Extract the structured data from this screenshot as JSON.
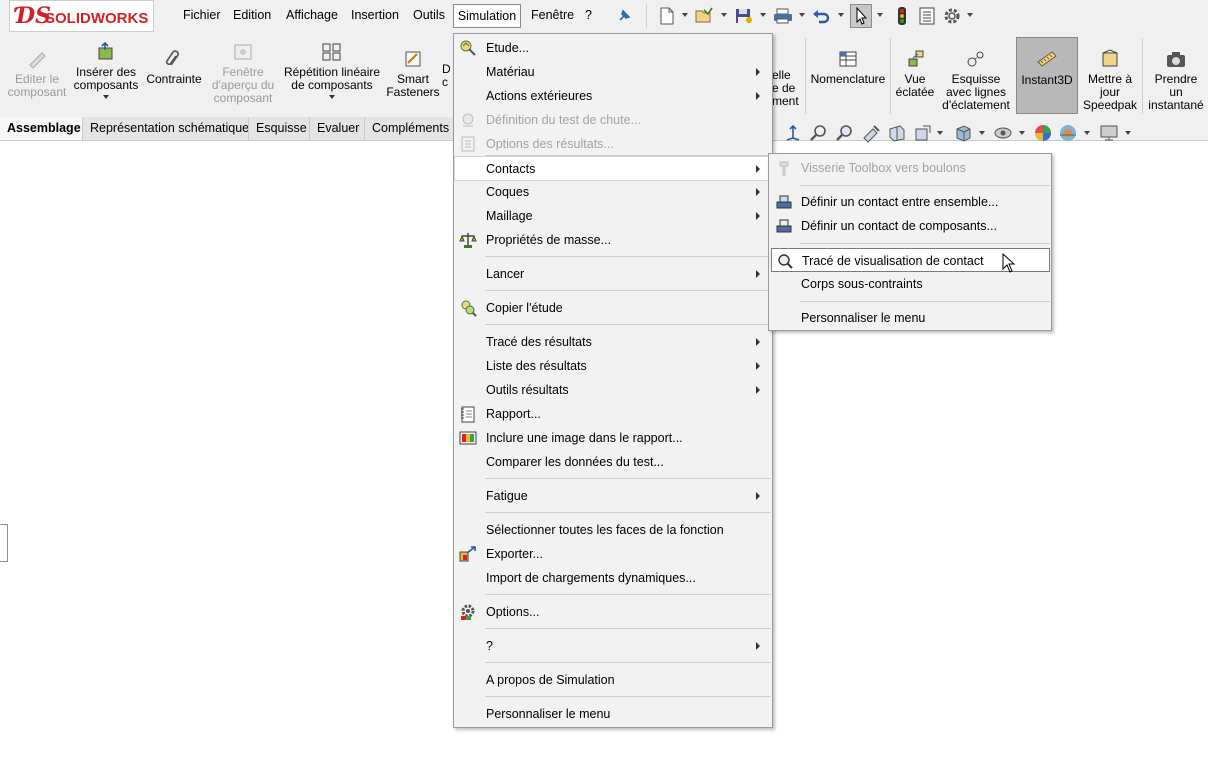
{
  "app": {
    "logo_ds": "ƊS",
    "logo_text": "SOLIDWORKS"
  },
  "menubar": {
    "items": [
      "Fichier",
      "Edition",
      "Affichage",
      "Insertion",
      "Outils",
      "Simulation",
      "Fenêtre",
      "?"
    ]
  },
  "ribbon": {
    "left_commands": [
      {
        "label_1": "Editer le",
        "label_2": "composant",
        "label_3": "",
        "disabled": true
      },
      {
        "label_1": "Insérer des",
        "label_2": "composants",
        "label_3": "",
        "disabled": false
      },
      {
        "label_1": "Contrainte",
        "label_2": "",
        "label_3": "",
        "disabled": false
      },
      {
        "label_1": "Fenêtre",
        "label_2": "d'aperçu du",
        "label_3": "composant",
        "disabled": true
      },
      {
        "label_1": "Répétition linéaire",
        "label_2": "de composants",
        "label_3": "",
        "disabled": false
      },
      {
        "label_1": "Smart",
        "label_2": "Fasteners",
        "label_3": "",
        "disabled": false
      },
      {
        "label_1": "D",
        "label_2": "c",
        "label_3": "",
        "disabled": false
      }
    ],
    "right_commands": [
      {
        "label_1": "elle",
        "label_2": "e de",
        "label_3": "ment"
      },
      {
        "label_1": "Nomenclature",
        "label_2": "",
        "label_3": ""
      },
      {
        "label_1": "Vue",
        "label_2": "éclatée",
        "label_3": ""
      },
      {
        "label_1": "Esquisse",
        "label_2": "avec lignes",
        "label_3": "d'éclatement"
      },
      {
        "label_1": "Instant3D",
        "label_2": "",
        "label_3": ""
      },
      {
        "label_1": "Mettre à",
        "label_2": "jour",
        "label_3": "Speedpak"
      },
      {
        "label_1": "Prendre",
        "label_2": "un",
        "label_3": "instantané"
      }
    ]
  },
  "tabs": [
    "Assemblage",
    "Représentation schématique",
    "Esquisse",
    "Evaluer",
    "Compléments"
  ],
  "simulation_menu": {
    "items": [
      {
        "label": "Etude...",
        "disabled": false,
        "submenu": false,
        "icon": "study-icon"
      },
      {
        "label": "Matériau",
        "disabled": false,
        "submenu": true,
        "icon": ""
      },
      {
        "label": "Actions extérieures",
        "disabled": false,
        "submenu": true,
        "icon": ""
      },
      {
        "label": "Définition du test de chute...",
        "disabled": true,
        "submenu": false,
        "icon": "drop-test-icon"
      },
      {
        "label": "Options des résultats...",
        "disabled": true,
        "submenu": false,
        "icon": "result-options-icon"
      },
      {
        "label": "Contacts",
        "disabled": false,
        "submenu": true,
        "icon": ""
      },
      {
        "label": "Coques",
        "disabled": false,
        "submenu": true,
        "icon": ""
      },
      {
        "label": "Maillage",
        "disabled": false,
        "submenu": true,
        "icon": ""
      },
      {
        "label": "Propriétés de masse...",
        "disabled": false,
        "submenu": false,
        "icon": "mass-properties-icon"
      },
      {
        "label": "Lancer",
        "disabled": false,
        "submenu": true,
        "icon": ""
      },
      {
        "label": "Copier l'étude",
        "disabled": false,
        "submenu": false,
        "icon": "copy-study-icon"
      },
      {
        "label": "Tracé des résultats",
        "disabled": false,
        "submenu": true,
        "icon": ""
      },
      {
        "label": "Liste des résultats",
        "disabled": false,
        "submenu": true,
        "icon": ""
      },
      {
        "label": "Outils résultats",
        "disabled": false,
        "submenu": true,
        "icon": ""
      },
      {
        "label": "Rapport...",
        "disabled": false,
        "submenu": false,
        "icon": "report-icon"
      },
      {
        "label": "Inclure une image dans le rapport...",
        "disabled": false,
        "submenu": false,
        "icon": "include-image-icon"
      },
      {
        "label": "Comparer les données du test...",
        "disabled": false,
        "submenu": false,
        "icon": ""
      },
      {
        "label": "Fatigue",
        "disabled": false,
        "submenu": true,
        "icon": ""
      },
      {
        "label": "Sélectionner toutes les faces de la fonction",
        "disabled": false,
        "submenu": false,
        "icon": ""
      },
      {
        "label": "Exporter...",
        "disabled": false,
        "submenu": false,
        "icon": "export-icon"
      },
      {
        "label": "Import de chargements dynamiques...",
        "disabled": false,
        "submenu": false,
        "icon": ""
      },
      {
        "label": "Options...",
        "disabled": false,
        "submenu": false,
        "icon": "options-gear-icon"
      },
      {
        "label": "?",
        "disabled": false,
        "submenu": true,
        "icon": ""
      },
      {
        "label": "A propos de Simulation",
        "disabled": false,
        "submenu": false,
        "icon": ""
      },
      {
        "label": "Personnaliser le menu",
        "disabled": false,
        "submenu": false,
        "icon": ""
      }
    ],
    "highlighted": "Contacts"
  },
  "contacts_submenu": {
    "items": [
      {
        "label": "Visserie Toolbox vers boulons",
        "disabled": true,
        "icon": "toolbox-bolt-icon"
      },
      {
        "label": "Définir un contact entre ensemble...",
        "disabled": false,
        "icon": "contact-set-icon"
      },
      {
        "label": "Définir un contact de composants...",
        "disabled": false,
        "icon": "component-contact-icon"
      },
      {
        "label": "Tracé de visualisation de contact",
        "disabled": false,
        "icon": "contact-visualization-icon"
      },
      {
        "label": "Corps sous-contraints",
        "disabled": false,
        "icon": ""
      },
      {
        "label": "Personnaliser le menu",
        "disabled": false,
        "icon": ""
      }
    ],
    "highlighted": "Tracé de visualisation de contact"
  },
  "colors": {
    "accent_red": "#d41f26",
    "menu_bg": "#f2f2f2",
    "ribbon_bg": "#f0f0f0"
  }
}
